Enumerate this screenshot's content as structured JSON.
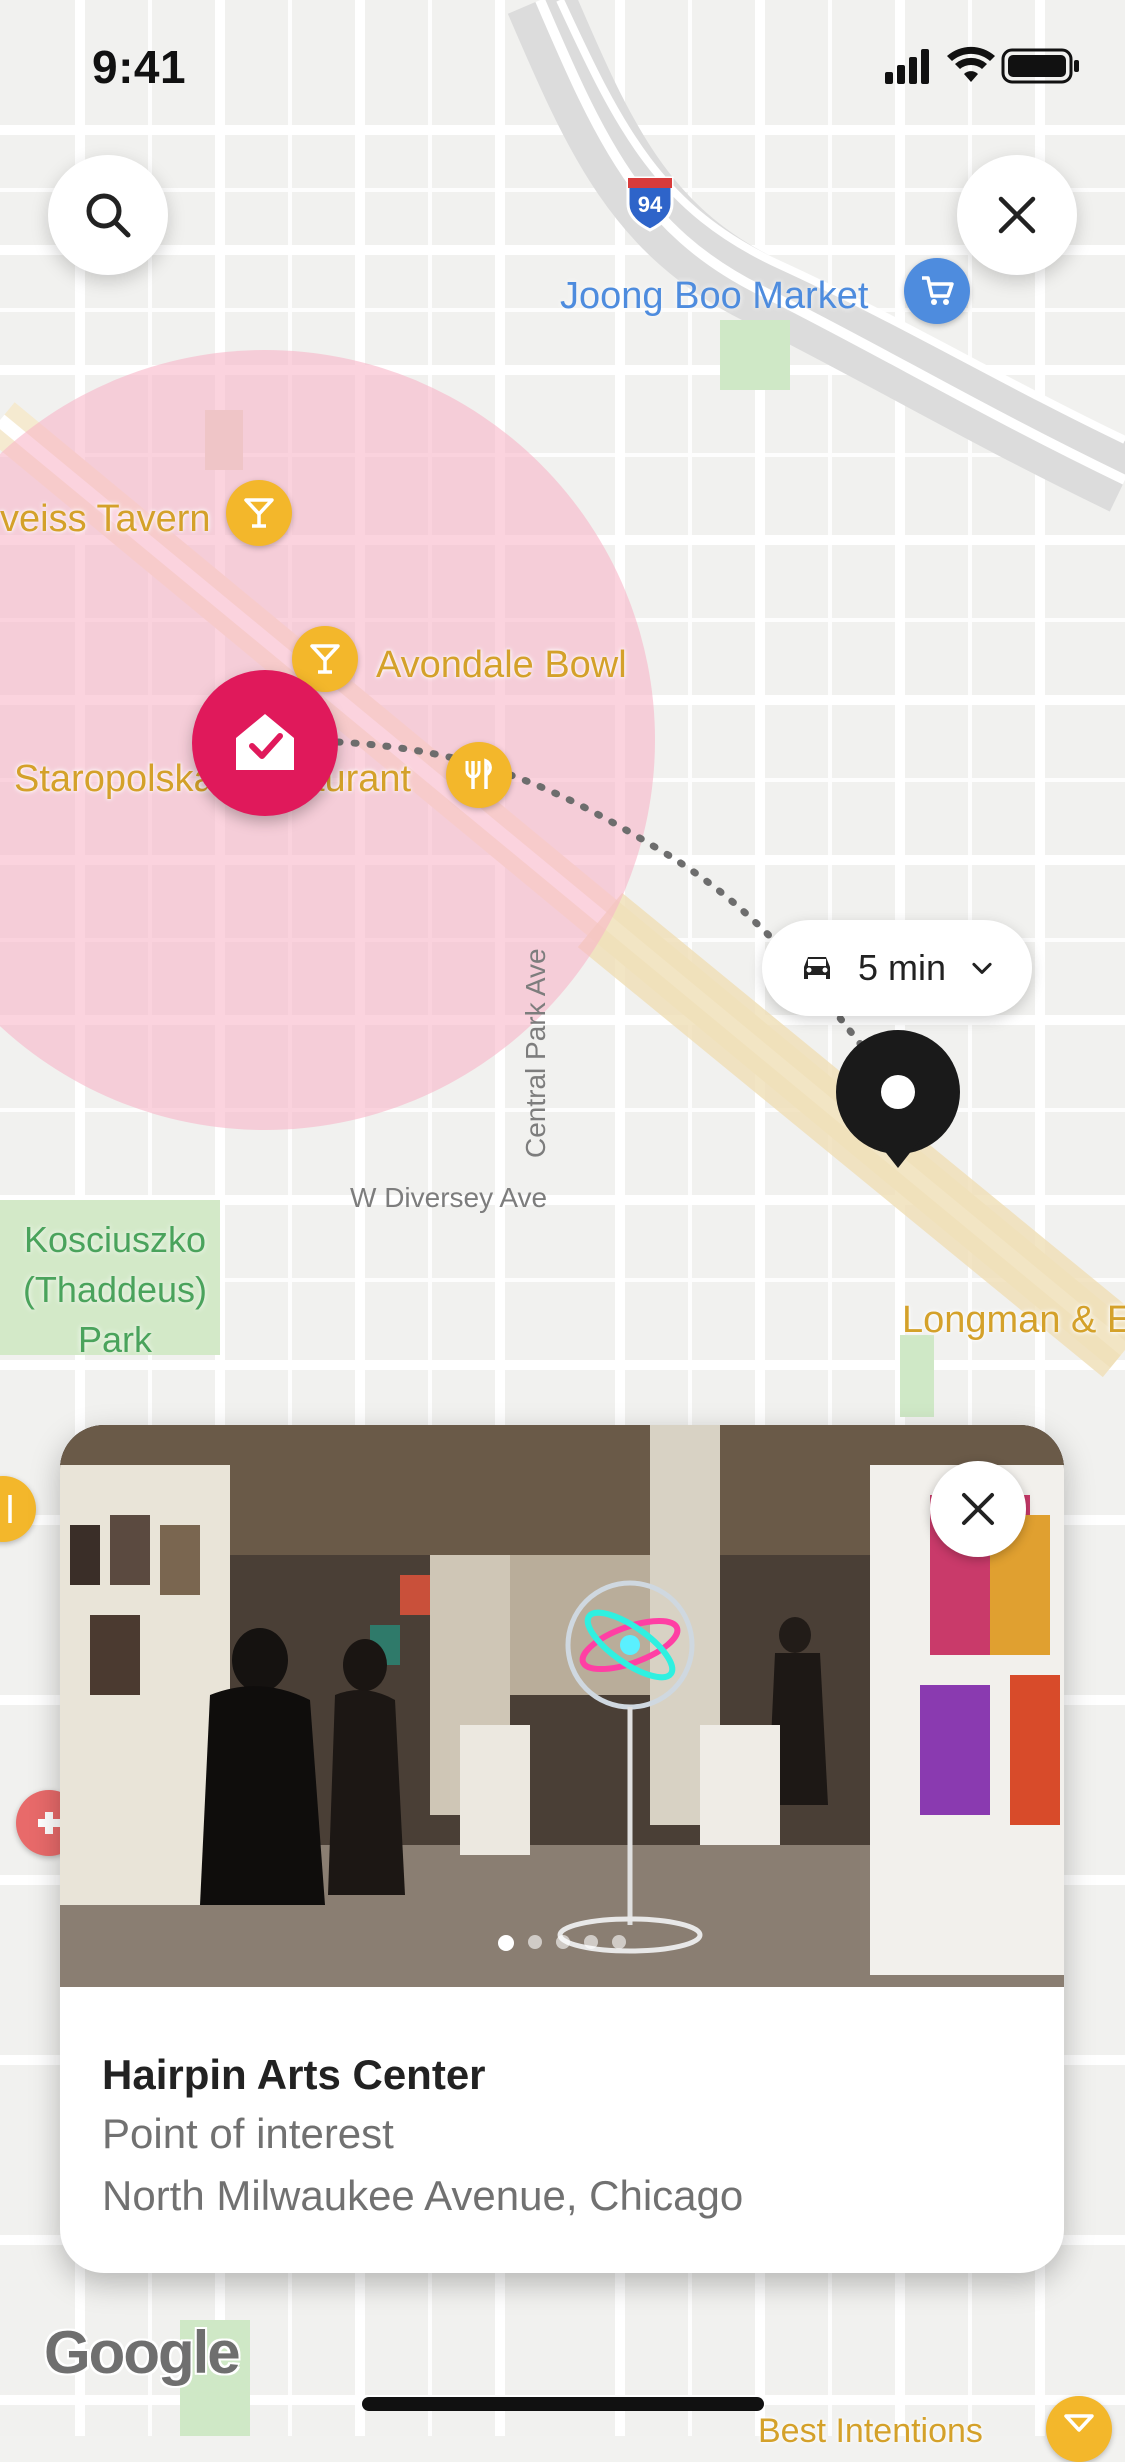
{
  "status_bar": {
    "time": "9:41"
  },
  "map": {
    "highway_shield": "94",
    "labels": {
      "joong_boo": "Joong Boo Market",
      "weiss_tavern": "veiss Tavern",
      "avondale_bowl": "Avondale Bowl",
      "staropolska": "Staropolska Restaurant",
      "kosciuszko": "Kosciuszko\n(Thaddeus)\nPark",
      "diversey": "W Diversey Ave",
      "central_park": "Central Park Ave",
      "longman": "Longman & E",
      "best_intentions": "Best Intentions"
    },
    "colors": {
      "radius_fill": "#f8c6d3",
      "home_pin": "#e0195b",
      "poi_orange": "#f3b72b",
      "poi_blue": "#4e8cde"
    }
  },
  "controls": {
    "search_icon": "search-icon",
    "close_icon": "close-icon"
  },
  "drive_chip": {
    "label": "5 min",
    "icon": "car-icon"
  },
  "place_card": {
    "name": "Hairpin Arts Center",
    "type": "Point of interest",
    "address": "North Milwaukee Avenue, Chicago",
    "photo_count": 5,
    "active_photo": 1
  },
  "attribution": "Google"
}
